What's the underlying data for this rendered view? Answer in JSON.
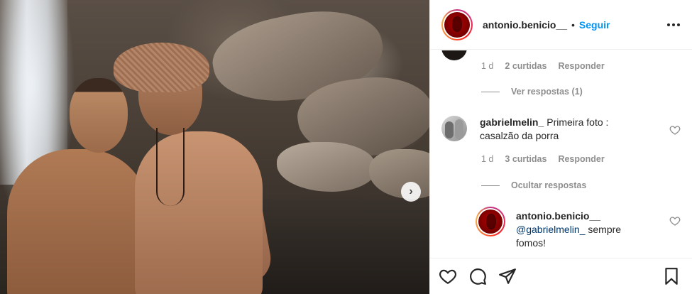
{
  "header": {
    "username": "antonio.benicio__",
    "separator": "•",
    "follow_label": "Seguir",
    "more_icon": "more-options-icon"
  },
  "comments": {
    "first_meta": {
      "age": "1 d",
      "likes": "2 curtidas",
      "reply": "Responder"
    },
    "first_replies_toggle": "Ver respostas (1)",
    "second": {
      "username": "gabrielmelin_",
      "text": "Primeira foto : casalzão da porra",
      "meta": {
        "age": "1 d",
        "likes": "3 curtidas",
        "reply": "Responder"
      },
      "replies_toggle": "Ocultar respostas"
    },
    "reply": {
      "username": "antonio.benicio__",
      "mention": "@gabrielmelin_",
      "text": " sempre fomos!"
    }
  },
  "carousel": {
    "next_icon": "chevron-right-icon",
    "glyph": "›"
  },
  "actions": [
    "heart-icon",
    "comment-icon",
    "share-icon",
    "bookmark-icon"
  ],
  "colors": {
    "follow": "#0095f6",
    "mention": "#00376b",
    "muted": "#8e8e8e"
  }
}
